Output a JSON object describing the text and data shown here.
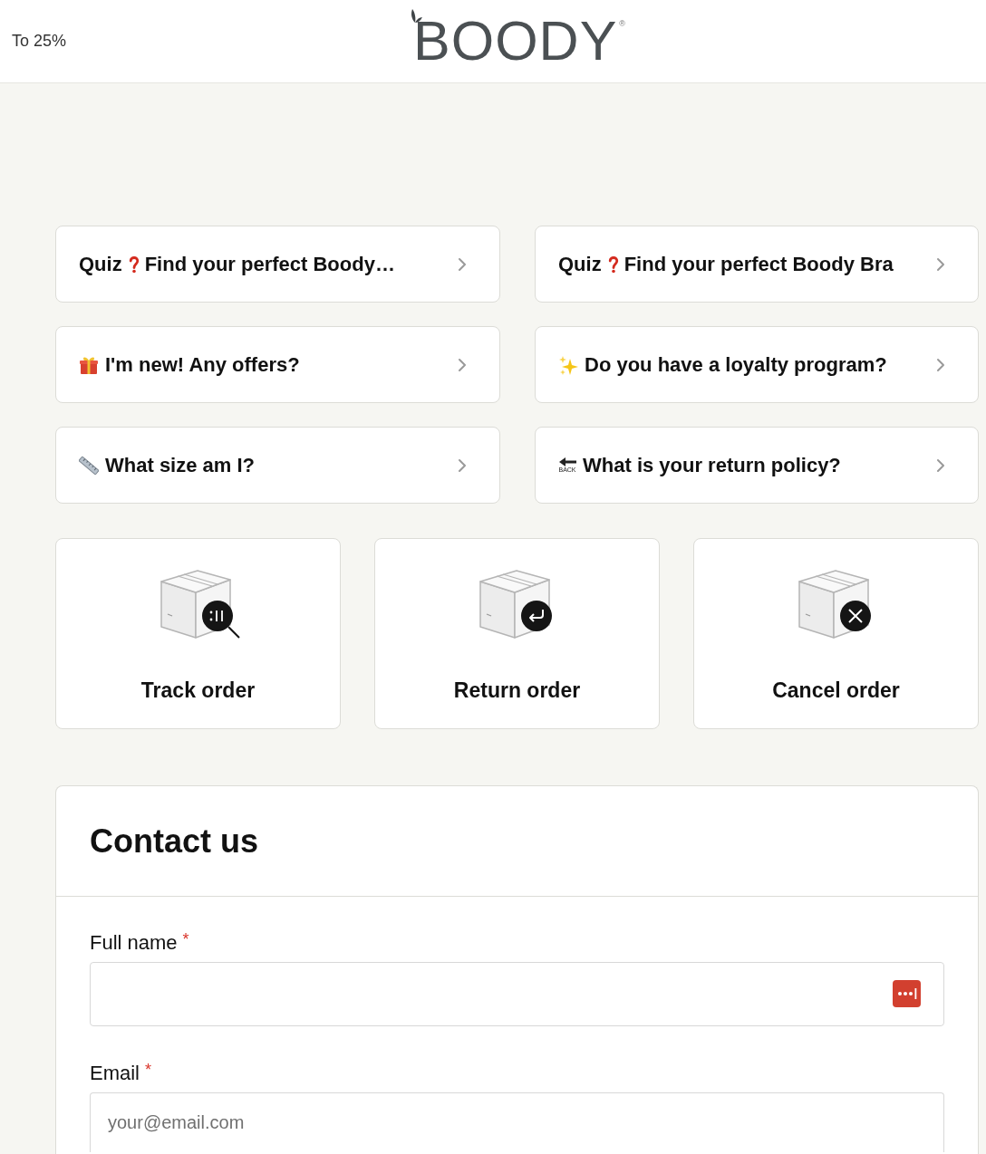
{
  "header": {
    "promo": "To 25%",
    "logo": "BOODY",
    "logo_mark": "®"
  },
  "quick_links": [
    {
      "kind": "quiz",
      "prefix": "Quiz",
      "label": "Find your perfect Boody…"
    },
    {
      "kind": "quiz",
      "prefix": "Quiz",
      "label": "Find your perfect Boody Bra"
    },
    {
      "kind": "gift",
      "label": "I'm new! Any offers?"
    },
    {
      "kind": "sparkles",
      "label": "Do you have a loyalty program?"
    },
    {
      "kind": "ruler",
      "label": "What size am I?"
    },
    {
      "kind": "back",
      "icon_text": "BACK",
      "label": "What is your return policy?"
    }
  ],
  "order_actions": [
    {
      "kind": "track",
      "label": "Track order"
    },
    {
      "kind": "return",
      "label": "Return order"
    },
    {
      "kind": "cancel",
      "label": "Cancel order"
    }
  ],
  "contact": {
    "title": "Contact us",
    "fields": [
      {
        "label": "Full name",
        "required_mark": "*",
        "autofill_icon": true
      },
      {
        "label": "Email",
        "required_mark": "*",
        "placeholder": "your@email.com",
        "autofill_icon": false
      }
    ]
  }
}
